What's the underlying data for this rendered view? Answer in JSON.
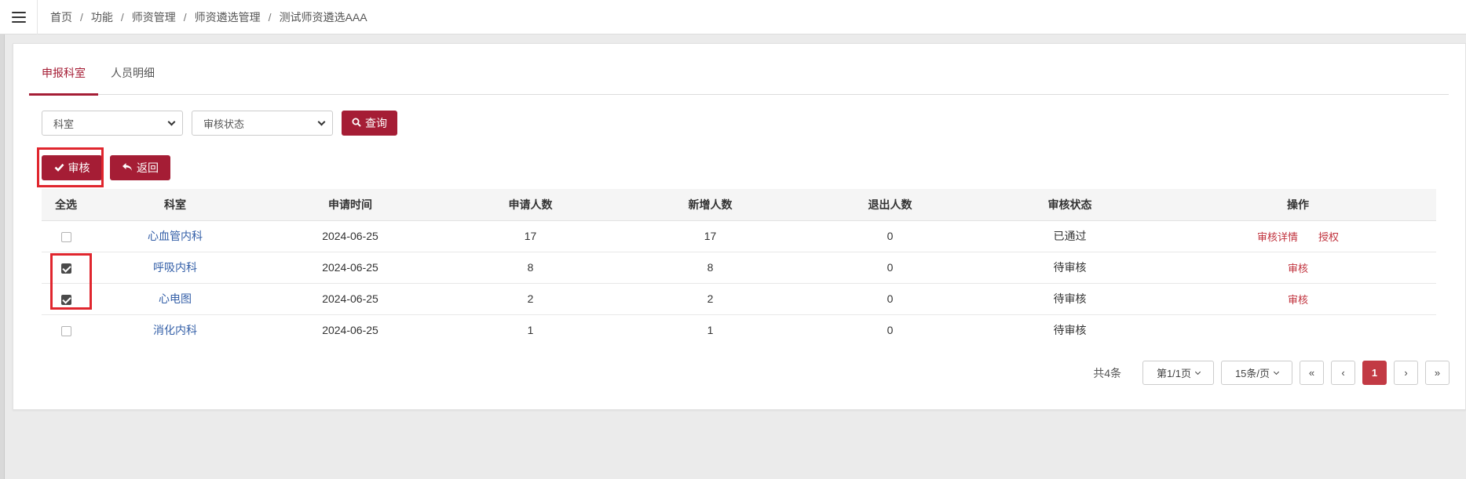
{
  "breadcrumb": [
    "首页",
    "功能",
    "师资管理",
    "师资遴选管理",
    "测试师资遴选AAA"
  ],
  "tabs": [
    {
      "label": "申报科室",
      "active": true
    },
    {
      "label": "人员明细",
      "active": false
    }
  ],
  "filters": {
    "department_select": "科室",
    "status_select": "审核状态",
    "query_button": "查询"
  },
  "actions": {
    "approve_button": "审核",
    "back_button": "返回"
  },
  "table": {
    "headers": [
      "全选",
      "科室",
      "申请时间",
      "申请人数",
      "新增人数",
      "退出人数",
      "审核状态",
      "操作"
    ],
    "rows": [
      {
        "checked": false,
        "department": "心血管内科",
        "date": "2024-06-25",
        "applicants": "17",
        "added": "17",
        "withdrawn": "0",
        "status": "已通过",
        "ops": [
          "审核详情",
          "授权"
        ]
      },
      {
        "checked": true,
        "department": "呼吸内科",
        "date": "2024-06-25",
        "applicants": "8",
        "added": "8",
        "withdrawn": "0",
        "status": "待审核",
        "ops": [
          "审核"
        ]
      },
      {
        "checked": true,
        "department": "心电图",
        "date": "2024-06-25",
        "applicants": "2",
        "added": "2",
        "withdrawn": "0",
        "status": "待审核",
        "ops": [
          "审核"
        ]
      },
      {
        "checked": false,
        "department": "消化内科",
        "date": "2024-06-25",
        "applicants": "1",
        "added": "1",
        "withdrawn": "0",
        "status": "待审核",
        "ops": []
      }
    ]
  },
  "pagination": {
    "total": "共4条",
    "page_info": "第1/1页",
    "page_size": "15条/页",
    "first": "«",
    "prev": "‹",
    "current": "1",
    "next": "›",
    "last": "»"
  },
  "colors": {
    "brand": "#a51d35",
    "link_blue": "#3560a8",
    "op_red": "#c0313c",
    "highlight": "#e0262e"
  }
}
